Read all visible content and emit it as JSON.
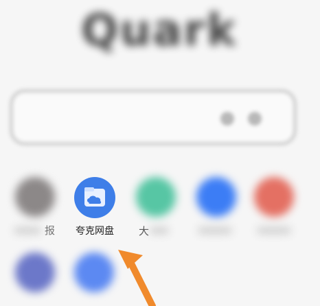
{
  "app": {
    "logo_text": "Quark"
  },
  "shortcuts": {
    "partial_label_1": "报",
    "highlighted_label": "夸克网盘",
    "partial_label_3": "大"
  },
  "colors": {
    "accent": "#3e7ee8",
    "arrow": "#f08a2c"
  }
}
